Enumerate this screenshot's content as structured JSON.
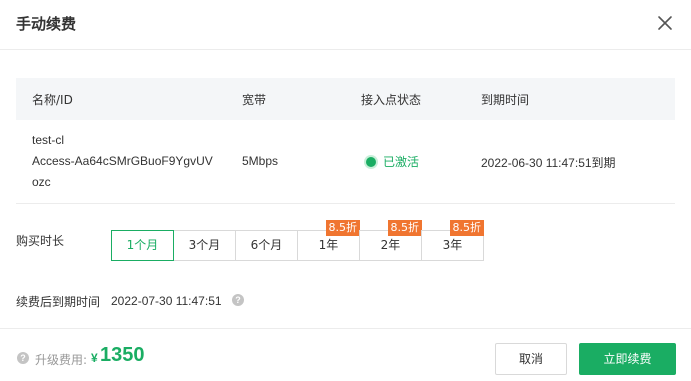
{
  "dialog": {
    "title": "手动续费",
    "close_icon": "close-icon"
  },
  "table": {
    "columns": [
      "名称/ID",
      "宽带",
      "接入点状态",
      "到期时间"
    ],
    "rows": [
      {
        "name_line1": "test-cl",
        "name_line2": "Access-Aa64cSMrGBuoF9YgvUV",
        "name_line3": "ozc",
        "bandwidth": "5Mbps",
        "status": "已激活",
        "status_color": "#1aad63",
        "expire": "2022-06-30 11:47:51到期"
      }
    ]
  },
  "duration": {
    "label": "购买时长",
    "options": [
      {
        "label": "1个月",
        "selected": true,
        "badge": ""
      },
      {
        "label": "3个月",
        "selected": false,
        "badge": ""
      },
      {
        "label": "6个月",
        "selected": false,
        "badge": ""
      },
      {
        "label": "1年",
        "selected": false,
        "badge": "8.5折"
      },
      {
        "label": "2年",
        "selected": false,
        "badge": "8.5折"
      },
      {
        "label": "3年",
        "selected": false,
        "badge": "8.5折"
      }
    ],
    "badge_color": "#f07530"
  },
  "expiry_after": {
    "label": "续费后到期时间",
    "value": "2022-07-30 11:47:51",
    "help_icon": "question-circle-icon"
  },
  "footer": {
    "help_icon": "question-circle-icon",
    "fee_label": "升级费用:",
    "currency": "¥",
    "amount": "1350",
    "cancel_label": "取消",
    "confirm_label": "立即续费",
    "accent_color": "#1aad63"
  }
}
